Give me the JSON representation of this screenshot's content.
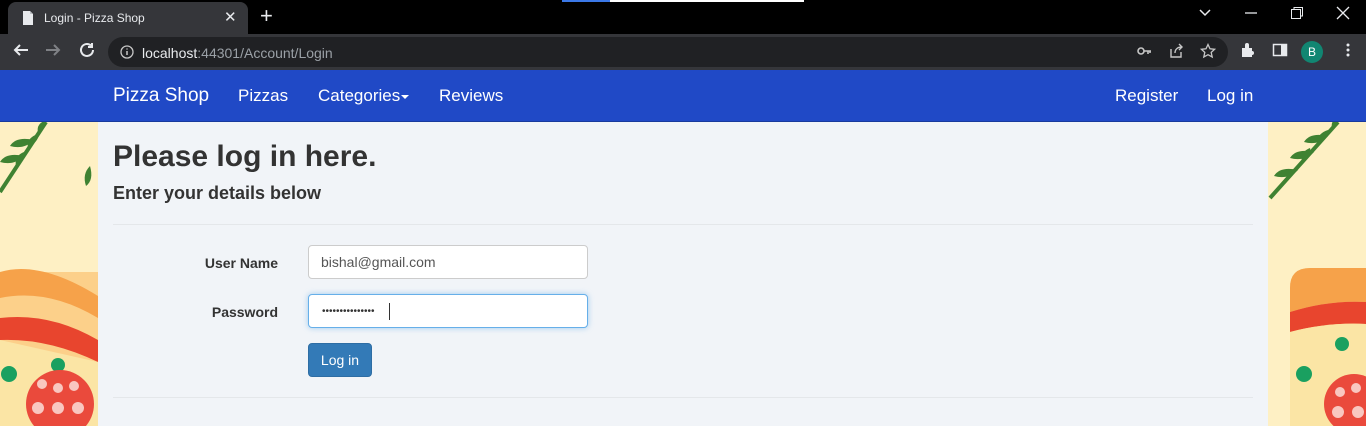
{
  "browser": {
    "tab_title": "Login - Pizza Shop",
    "tab_close_glyph": "✕",
    "new_tab_glyph": "+",
    "url_host": "localhost",
    "url_path": ":44301/Account/Login",
    "profile_initial": "B",
    "icons": [
      "back-arrow-icon",
      "forward-arrow-icon",
      "reload-icon",
      "info-icon",
      "key-icon",
      "share-icon",
      "star-icon",
      "extensions-icon",
      "side-panel-icon",
      "menu-dots-icon"
    ]
  },
  "navbar": {
    "brand": "Pizza Shop",
    "links": [
      "Pizzas",
      "Categories",
      "Reviews"
    ],
    "right_links": [
      "Register",
      "Log in"
    ],
    "color": "#2049c6"
  },
  "form": {
    "title": "Please log in here.",
    "subtitle": "Enter your details below",
    "username_label": "User Name",
    "username_value": "bishal@gmail.com",
    "password_label": "Password",
    "password_masked": "•••••••••••••••",
    "submit_label": "Log in",
    "button_color": "#337ab7"
  }
}
